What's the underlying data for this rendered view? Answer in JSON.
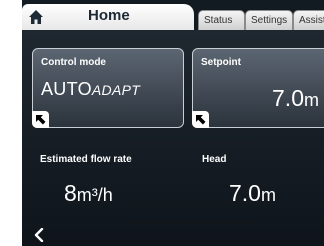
{
  "tabs": {
    "home_label": "Home",
    "items": [
      "Status",
      "Settings",
      "Assist"
    ]
  },
  "cards": {
    "control_mode": {
      "title": "Control mode",
      "value_main": "AUTO",
      "value_suffix": "ADAPT"
    },
    "setpoint": {
      "title": "Setpoint",
      "value": "7.0",
      "unit": "m"
    }
  },
  "stats": {
    "flow": {
      "label": "Estimated flow rate",
      "value": "8",
      "unit": "m³/h"
    },
    "head": {
      "label": "Head",
      "value": "7.0",
      "unit": "m"
    }
  },
  "icons": {
    "home": "home-icon",
    "edit_arrow": "arrow-up-left-icon",
    "back": "chevron-left-icon"
  },
  "colors": {
    "background": "#121a22",
    "card": "#4a545f",
    "text": "#ffffff",
    "tab_active": "#ffffff"
  }
}
